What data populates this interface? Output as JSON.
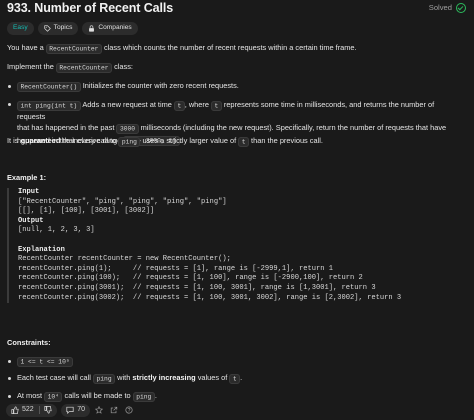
{
  "problem": {
    "title": "933. Number of Recent Calls",
    "status": "Solved",
    "tags": {
      "difficulty": "Easy",
      "topics": "Topics",
      "companies": "Companies"
    }
  },
  "description": {
    "intro_a": "You have a ",
    "intro_code": "RecentCounter",
    "intro_b": " class which counts the number of recent requests within a certain time frame.",
    "impl_a": "Implement the ",
    "impl_code": "RecentCounter",
    "impl_b": " class:",
    "b1_code": "RecentCounter()",
    "b1_text": " Initializes the counter with zero recent requests.",
    "b2_code": "int ping(int t)",
    "b2_a": " Adds a new request at time ",
    "b2_t1": "t",
    "b2_b": ", where ",
    "b2_t2": "t",
    "b2_c": " represents some time in milliseconds, and returns the number of requests",
    "b2_d": "that has happened in the past ",
    "b2_ms": "3000",
    "b2_e": " milliseconds (including the new request). Specifically, return the number of requests that have",
    "b2_f": "happened in the inclusive range ",
    "b2_range": "[t - 3000, t]",
    "b2_g": ".",
    "g_a": "It is ",
    "g_strong": "guaranteed",
    "g_b": " that every call to ",
    "g_ping": "ping",
    "g_c": " uses a strictly larger value of ",
    "g_t": "t",
    "g_d": " than the previous call."
  },
  "example": {
    "title": "Example 1:",
    "input_label": "Input",
    "input_l1": "[\"RecentCounter\", \"ping\", \"ping\", \"ping\", \"ping\"]",
    "input_l2": "[[], [1], [100], [3001], [3002]]",
    "output_label": "Output",
    "output_l1": "[null, 1, 2, 3, 3]",
    "explanation_label": "Explanation",
    "exp_lines": [
      "RecentCounter recentCounter = new RecentCounter();",
      "recentCounter.ping(1);     // requests = [1], range is [-2999,1], return 1",
      "recentCounter.ping(100);   // requests = [1, 100], range is [-2900,100], return 2",
      "recentCounter.ping(3001);  // requests = [1, 100, 3001], range is [1,3001], return 3",
      "recentCounter.ping(3002);  // requests = [1, 100, 3001, 3002], range is [2,3002], return 3"
    ]
  },
  "constraints": {
    "title": "Constraints:",
    "c1_code": "1 <= t <= 10⁹",
    "c2_a": "Each test case will call ",
    "c2_code": "ping",
    "c2_b": " with ",
    "c2_strong": "strictly increasing",
    "c2_c": " values of ",
    "c2_t": "t",
    "c2_d": ".",
    "c3_a": "At most ",
    "c3_code": "10⁴",
    "c3_b": " calls will be made to ",
    "c3_ping": "ping",
    "c3_c": "."
  },
  "footer": {
    "likes": "522",
    "comments": "70"
  },
  "colors": {
    "background": "#1a1a1a",
    "easy": "#15bdb3",
    "solved": "#2cbb5d"
  }
}
